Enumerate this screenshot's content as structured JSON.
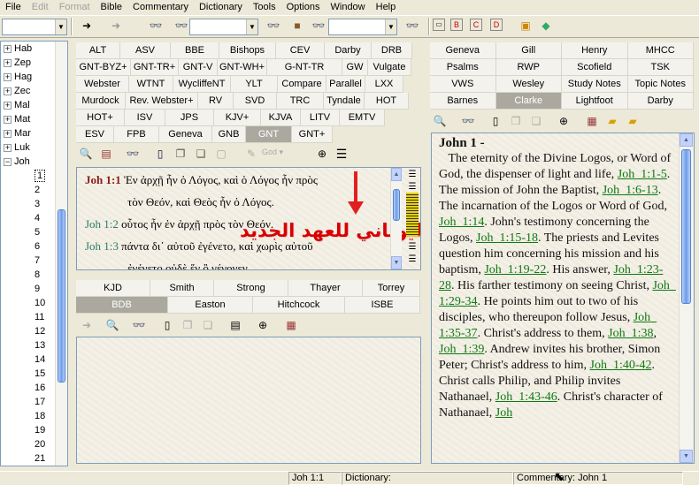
{
  "menu": [
    "File",
    "Edit",
    "Format",
    "Bible",
    "Commentary",
    "Dictionary",
    "Tools",
    "Options",
    "Window",
    "Help"
  ],
  "menu_disabled": [
    false,
    true,
    true,
    false,
    false,
    false,
    false,
    false,
    false,
    false
  ],
  "tree": {
    "books": [
      "Hab",
      "Zep",
      "Hag",
      "Zec",
      "Mal",
      "Mat",
      "Mar",
      "Luk",
      "Joh"
    ],
    "expanded_book": "Joh",
    "chapters": [
      "1",
      "2",
      "3",
      "4",
      "5",
      "6",
      "7",
      "8",
      "9",
      "10",
      "11",
      "12",
      "13",
      "14",
      "15",
      "16",
      "17",
      "18",
      "19",
      "20",
      "21"
    ],
    "selected_chapter": "1"
  },
  "bible_tabs": [
    "ALT",
    "ASV",
    "BBE",
    "Bishops",
    "CEV",
    "Darby",
    "DRB",
    "GNT-BYZ+",
    "GNT-TR+",
    "GNT-V",
    "GNT-WH+",
    "G-NT-TR (Steph)+",
    "GW",
    "Vulgate",
    "Webster",
    "WTNT",
    "WycliffeNT",
    "YLT",
    "Compare",
    "Parallel",
    "LXX",
    "Murdock",
    "Rev. Webster+",
    "RV",
    "SVD",
    "TRC",
    "Tyndale",
    "HOT",
    "HOT+",
    "ISV",
    "JPS",
    "KJV+",
    "KJVA",
    "LITV",
    "EMTV",
    "ESV",
    "FPB",
    "Geneva",
    "GNB",
    "GNT",
    "GNT+"
  ],
  "bible_active": "GNT",
  "god_label": "God",
  "verses": [
    {
      "ref": "Joh 1:1",
      "text": "Ἐν ἀρχῇ ἦν ὁ Λόγος, καὶ ὁ Λόγος ἦν πρὸς",
      "cont": "τὸν Θεόν, καὶ Θεὸς ἦν ὁ Λόγος."
    },
    {
      "ref": "Joh 1:2",
      "text": "οὗτος ἦν ἐν ἀρχῇ πρὸς τὸν Θεόν."
    },
    {
      "ref": "Joh 1:3",
      "text": "πάντα δι᾽ αὐτοῦ ἐγένετο, καὶ χωρὶς αὐτοῦ",
      "cont": "ἐγένετο οὐδὲ ἕν ὃ γέγονεν."
    }
  ],
  "annotation": "الأصل اليوناني للعهد الجديد",
  "dict_tabs_row1": [
    "KJD",
    "Smith",
    "Strong",
    "Thayer",
    "Torrey"
  ],
  "dict_tabs_row2": [
    "BDB",
    "Easton",
    "Hitchcock",
    "ISBE"
  ],
  "dict_active": "BDB",
  "comm_tabs_row1": [
    "Geneva",
    "Gill",
    "Henry",
    "MHCC"
  ],
  "comm_tabs_row2": [
    "Psalms",
    "RWP",
    "Scofield",
    "TSK"
  ],
  "comm_tabs_row3": [
    "VWS",
    "Wesley",
    "Study Notes",
    "Topic Notes"
  ],
  "comm_tabs_row4": [
    "Barnes",
    "Clarke",
    "Lightfoot",
    "Darby"
  ],
  "comm_active": "Clarke",
  "commentary": {
    "heading": "John 1 -",
    "segments": [
      {
        "t": "   The eternity of the Divine Logos, or Word of God, the dispenser of light and life, "
      },
      {
        "l": "Joh  1:1-5"
      },
      {
        "t": ". The mission of John the Baptist, "
      },
      {
        "l": "Joh  1:6-13"
      },
      {
        "t": ". The incarnation of the Logos or Word of God, "
      },
      {
        "l": "Joh  1:14"
      },
      {
        "t": ". John's testimony concerning the Logos, "
      },
      {
        "l": "Joh  1:15-18"
      },
      {
        "t": ". The priests and Levites question him concerning his mission and his baptism, "
      },
      {
        "l": "Joh  1:19-22"
      },
      {
        "t": ". His answer, "
      },
      {
        "l": "Joh  1:23-28"
      },
      {
        "t": ". His farther testimony on seeing Christ, "
      },
      {
        "l": "Joh  1:29-34"
      },
      {
        "t": ". He points him out to two of his disciples, who thereupon follow Jesus, "
      },
      {
        "l": "Joh  1:35-37"
      },
      {
        "t": ". Christ's address to them, "
      },
      {
        "l": "Joh  1:38"
      },
      {
        "t": ", "
      },
      {
        "l": "Joh  1:39"
      },
      {
        "t": ". Andrew invites his brother, Simon Peter; Christ's address to him, "
      },
      {
        "l": "Joh  1:40-42"
      },
      {
        "t": ". Christ calls Philip, and Philip invites Nathanael, "
      },
      {
        "l": "Joh  1:43-46"
      },
      {
        "t": ". Christ's character of Nathanael, "
      },
      {
        "l": "Joh"
      }
    ]
  },
  "status": {
    "verse": "Joh 1:1",
    "dictionary": "Dictionary:",
    "commentary": "Commentary: John 1"
  }
}
